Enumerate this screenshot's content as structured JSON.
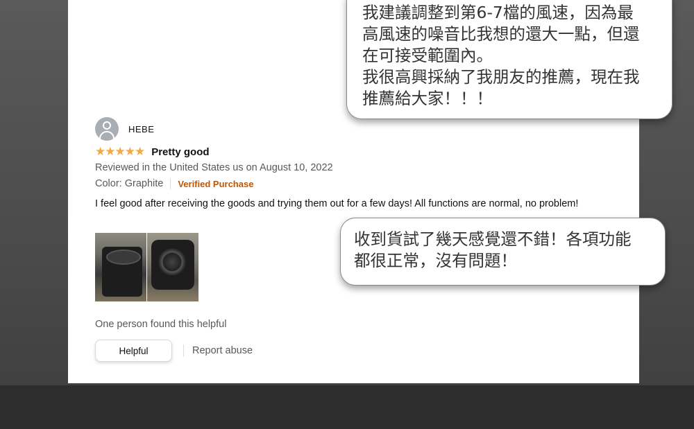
{
  "review": {
    "reviewer_name": "HEBE",
    "stars": "★★★★★",
    "rating": 5,
    "title": "Pretty good",
    "reviewed_line": "Reviewed in the United States us on August 10, 2022",
    "color_label": "Color: Graphite",
    "verified_label": "Verified Purchase",
    "body": "I feel good after receiving the goods and trying them out for a few days! All functions are normal, no problem!",
    "helpful_count_text": "One person found this helpful",
    "helpful_button": "Helpful",
    "report_link": "Report abuse"
  },
  "bubbles": {
    "top": [
      "我建議調整到第6-7檔的風速，因為最",
      "高風速的噪音比我想的還大一點，但還",
      "在可接受範圍內。",
      "我很高興採納了我朋友的推薦，現在我",
      "推薦給大家！！！"
    ],
    "bottom": [
      "收到貨試了幾天感覺還不錯！各項功能",
      "都很正常，沒有問題！"
    ]
  },
  "colors": {
    "star": "#f3a847",
    "verified": "#c45500",
    "meta_text": "#565959",
    "background": "#4a4a4a"
  },
  "icons": {
    "avatar": "user-avatar-icon",
    "star": "star-icon"
  }
}
